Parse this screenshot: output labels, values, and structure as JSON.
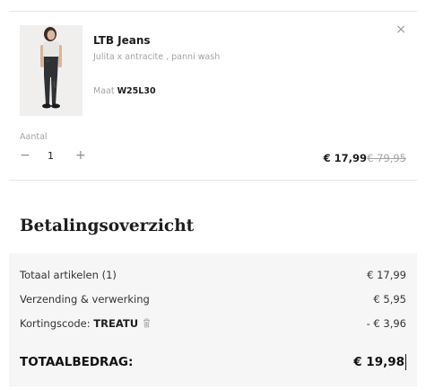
{
  "product": {
    "brand": "LTB Jeans",
    "description": "Julita x antracite , panni wash",
    "size_label": "Maat",
    "size_value": "W25L30",
    "quantity_label": "Aantal",
    "quantity": "1",
    "price_current": "€ 17,99",
    "price_original": "€ 79,95",
    "remove_icon": "close-icon",
    "image_icon": "product-thumbnail"
  },
  "summary": {
    "title": "Betalingsoverzicht",
    "rows": [
      {
        "label": "Totaal artikelen (1)",
        "value": "€ 17,99"
      },
      {
        "label": "Verzending & verwerking",
        "value": "€ 5,95"
      },
      {
        "label_prefix": "Kortingscode: ",
        "code": "TREATU",
        "value": "- € 3,96"
      }
    ],
    "total_label": "TOTAALBEDRAG:",
    "total_value": "€ 19,98"
  },
  "colors": {
    "background": "#ffffff",
    "summary_bg": "#f6f6f6",
    "muted_text": "#a3a3a3",
    "divider": "#e6e6e6"
  }
}
